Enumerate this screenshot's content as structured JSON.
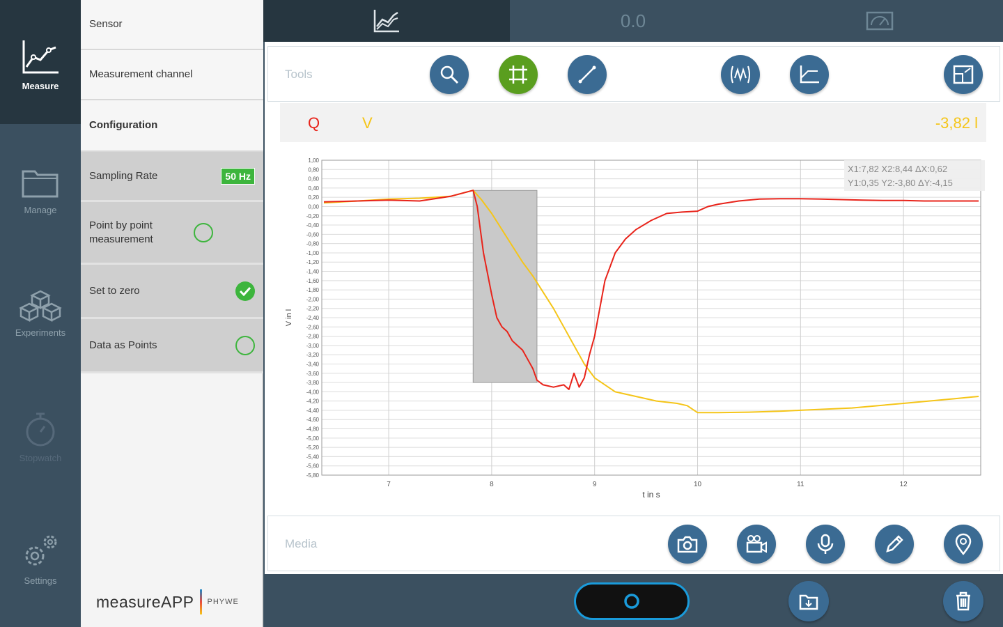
{
  "nav": {
    "measure": "Measure",
    "manage": "Manage",
    "experiments": "Experiments",
    "stopwatch": "Stopwatch",
    "settings": "Settings"
  },
  "panel": {
    "sensor": "Sensor",
    "channel": "Measurement channel",
    "configuration": "Configuration",
    "sampling_rate": "Sampling Rate",
    "sampling_value": "50 Hz",
    "point_by_point": "Point by point measurement",
    "set_to_zero": "Set to zero",
    "data_as_points": "Data as Points",
    "point_by_point_on": false,
    "set_to_zero_on": true,
    "data_as_points_on": false
  },
  "brand": {
    "app": "measureAPP",
    "company": "PHYWE"
  },
  "tabs": {
    "value": "0.0"
  },
  "tools": {
    "label": "Tools"
  },
  "media": {
    "label": "Media"
  },
  "legend": {
    "q": "Q",
    "v": "V",
    "value": "-3,82 l"
  },
  "readout": {
    "line1": "X1:7,82  X2:8,44  ΔX:0,62",
    "line2": "Y1:0,35  Y2:-3,80  ΔY:-4,15"
  },
  "colors": {
    "q": "#e8231a",
    "v": "#f5c518",
    "accent": "#3b6b93",
    "active": "#5a9e1f"
  },
  "chart_data": {
    "type": "line",
    "xlabel": "t in s",
    "ylabel": "V in l",
    "xlim": [
      6.35,
      12.75
    ],
    "ylim": [
      -5.8,
      1.0
    ],
    "xticks": [
      7,
      8,
      9,
      10,
      11,
      12
    ],
    "yticks": [
      "1,00",
      "0,80",
      "0,60",
      "0,40",
      "0,20",
      "0,00",
      "-0,20",
      "-0,40",
      "-0,60",
      "-0,80",
      "-1,00",
      "-1,20",
      "-1,40",
      "-1,60",
      "-1,80",
      "-2,00",
      "-2,20",
      "-2,40",
      "-2,60",
      "-2,80",
      "-3,00",
      "-3,20",
      "-3,40",
      "-3,60",
      "-3,80",
      "-4,00",
      "-4,20",
      "-4,40",
      "-4,60",
      "-4,80",
      "-5,00",
      "-5,20",
      "-5,40",
      "-5,60",
      "-5,80"
    ],
    "selection": {
      "x1": 7.82,
      "x2": 8.44,
      "y1": 0.35,
      "y2": -3.8
    },
    "series": [
      {
        "name": "Q",
        "color": "#e8231a",
        "x": [
          6.37,
          6.7,
          7.0,
          7.3,
          7.6,
          7.82,
          7.86,
          7.92,
          8.0,
          8.05,
          8.1,
          8.15,
          8.2,
          8.25,
          8.3,
          8.35,
          8.4,
          8.44,
          8.5,
          8.6,
          8.7,
          8.75,
          8.8,
          8.85,
          8.9,
          8.95,
          9.0,
          9.05,
          9.1,
          9.2,
          9.3,
          9.4,
          9.55,
          9.7,
          9.85,
          10.0,
          10.1,
          10.2,
          10.4,
          10.6,
          10.8,
          11.0,
          11.2,
          11.4,
          11.6,
          11.8,
          12.0,
          12.2,
          12.4,
          12.73
        ],
        "y": [
          0.1,
          0.12,
          0.14,
          0.12,
          0.22,
          0.35,
          0.0,
          -1.0,
          -1.9,
          -2.4,
          -2.6,
          -2.7,
          -2.9,
          -3.0,
          -3.1,
          -3.3,
          -3.5,
          -3.75,
          -3.85,
          -3.9,
          -3.85,
          -3.95,
          -3.6,
          -3.9,
          -3.7,
          -3.2,
          -2.8,
          -2.2,
          -1.6,
          -1.0,
          -0.7,
          -0.5,
          -0.3,
          -0.15,
          -0.12,
          -0.1,
          0.0,
          0.05,
          0.12,
          0.16,
          0.17,
          0.17,
          0.16,
          0.15,
          0.14,
          0.13,
          0.13,
          0.12,
          0.12,
          0.12
        ]
      },
      {
        "name": "V",
        "color": "#f5c518",
        "x": [
          6.37,
          6.7,
          7.0,
          7.3,
          7.6,
          7.82,
          7.9,
          8.0,
          8.1,
          8.2,
          8.3,
          8.4,
          8.5,
          8.6,
          8.7,
          8.8,
          8.9,
          9.0,
          9.1,
          9.2,
          9.4,
          9.6,
          9.8,
          9.9,
          10.0,
          10.2,
          10.5,
          10.8,
          11.0,
          11.5,
          12.0,
          12.5,
          12.73
        ],
        "y": [
          0.08,
          0.12,
          0.16,
          0.18,
          0.22,
          0.35,
          0.15,
          -0.15,
          -0.5,
          -0.85,
          -1.2,
          -1.5,
          -1.85,
          -2.2,
          -2.6,
          -3.0,
          -3.4,
          -3.7,
          -3.85,
          -4.0,
          -4.1,
          -4.2,
          -4.25,
          -4.3,
          -4.45,
          -4.45,
          -4.44,
          -4.42,
          -4.4,
          -4.35,
          -4.25,
          -4.15,
          -4.1
        ]
      }
    ]
  }
}
